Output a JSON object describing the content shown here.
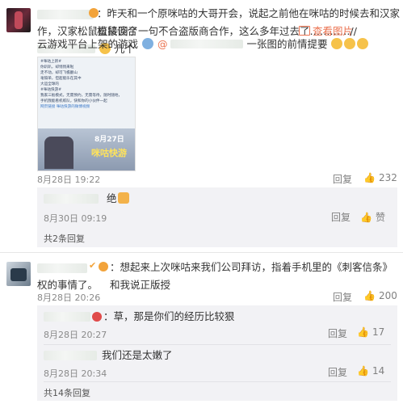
{
  "comment1": {
    "text_part1": "：昨天和一个原咪咕的大哥开会，说起之前他在咪咕的时候去和汉家松鼠谈合",
    "text_part2": "作，汉家松鼠直接回了一句不合盗版商合作，这么多年过去了…………//",
    "text_part3": "几个",
    "text_part4": "云游戏平台上架的游戏",
    "text_part5": "一张图的前情提要",
    "view_image": "查看图片",
    "image_lines": [
      "#咪咕上新#",
      "你趴趴，却悄悄来啦",
      "走不动，却可飞檐翻山",
      "毫隔单，但超能乐在其中",
      "大运全球的",
      "#咪咕快游#",
      "我家三板模式，无需预约，无需等待，随时随地，",
      "手机我能看机练队，快和你的小伙伴一起",
      "网页链接  咪咕快游的微博视频"
    ],
    "image_poster_date": "8月27日",
    "image_poster_title": "咪咕快游",
    "time": "8月28日 19:22",
    "reply_label": "回复",
    "like_count": "232",
    "reply1_text": "绝",
    "reply1_time": "8月30日 09:19",
    "reply1_reply": "回复",
    "reply1_like": "赞",
    "more_replies": "共2条回复"
  },
  "comment2": {
    "text_part1": "：想起来上次咪咕来我们公司拜访，指着手机里的《刺客信条》和我说正版授",
    "text_part2": "权的事情了。",
    "time": "8月28日 20:26",
    "reply_label": "回复",
    "like_count": "200",
    "reply1_text": "：草，那是你们的经历比较狠",
    "reply1_time": "8月28日 20:27",
    "reply1_reply": "回复",
    "reply1_like": "17",
    "reply2_text": "我们还是太嫩了",
    "reply2_time": "8月28日 20:34",
    "reply2_reply": "回复",
    "reply2_like": "14",
    "more_replies": "共14条回复"
  }
}
